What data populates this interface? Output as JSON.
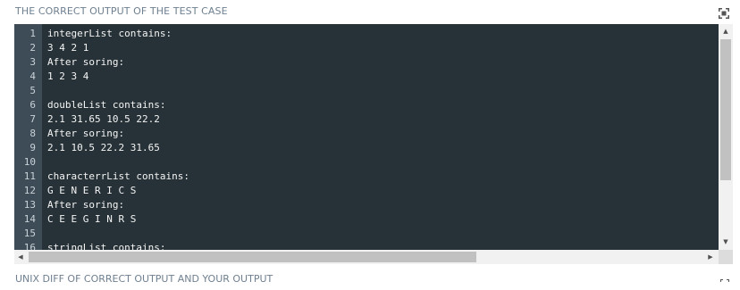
{
  "header": {
    "title": "THE CORRECT OUTPUT OF THE TEST CASE",
    "expand_icon": "fullscreen-icon"
  },
  "output": {
    "lines": [
      {
        "n": "1",
        "text": "integerList contains:"
      },
      {
        "n": "2",
        "text": "3 4 2 1"
      },
      {
        "n": "3",
        "text": "After soring:"
      },
      {
        "n": "4",
        "text": "1 2 3 4"
      },
      {
        "n": "5",
        "text": ""
      },
      {
        "n": "6",
        "text": "doubleList contains:"
      },
      {
        "n": "7",
        "text": "2.1 31.65 10.5 22.2"
      },
      {
        "n": "8",
        "text": "After soring:"
      },
      {
        "n": "9",
        "text": "2.1 10.5 22.2 31.65"
      },
      {
        "n": "10",
        "text": ""
      },
      {
        "n": "11",
        "text": "characterrList contains:"
      },
      {
        "n": "12",
        "text": "G E N E R I C S"
      },
      {
        "n": "13",
        "text": "After soring:"
      },
      {
        "n": "14",
        "text": "C E E G I N R S"
      },
      {
        "n": "15",
        "text": ""
      },
      {
        "n": "16",
        "text": "stringList contains:"
      }
    ]
  },
  "colors": {
    "editor_bg": "#273238",
    "gutter_bg": "#3d4c57",
    "header_text": "#6f8090"
  },
  "footer": {
    "title": "UNIX DIFF OF CORRECT OUTPUT AND YOUR OUTPUT"
  }
}
